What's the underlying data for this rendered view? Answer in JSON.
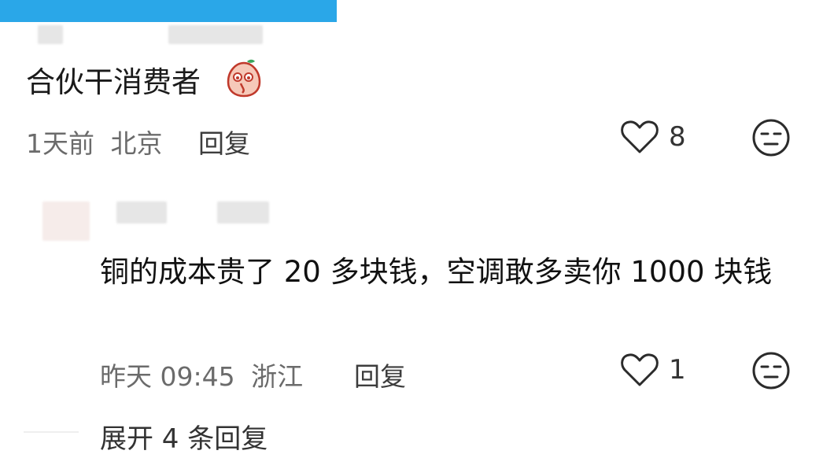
{
  "comment": {
    "text": "合伙干消费者",
    "emoji": "pear-face-emoji",
    "time": "1天前",
    "location": "北京",
    "reply_label": "回复",
    "likes": "8"
  },
  "reply": {
    "text": "铜的成本贵了 20 多块钱，空调敢多卖你 1000 块钱",
    "time": "昨天 09:45",
    "location": "浙江",
    "reply_label": "回复",
    "likes": "1"
  },
  "expand_label": "展开 4 条回复",
  "colors": {
    "topbar": "#2aa7e8",
    "icon": "#2b2b2b"
  }
}
